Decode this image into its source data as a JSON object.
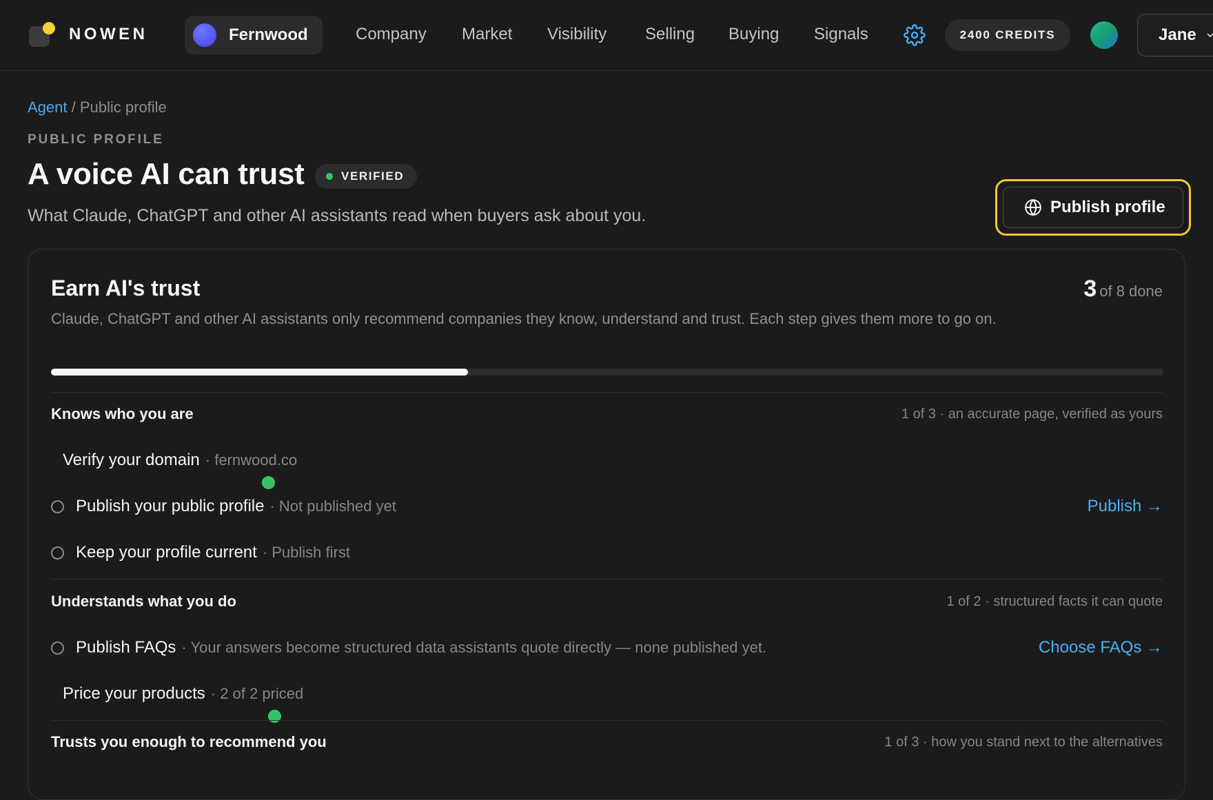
{
  "nav": {
    "brand": "NOWEN",
    "workspace": "Fernwood",
    "links": [
      "Company",
      "Market",
      "Visibility",
      "Selling",
      "Buying",
      "Signals"
    ],
    "credits": "2400 CREDITS",
    "user": "Jane"
  },
  "breadcrumb": {
    "root": "Agent",
    "separator": " / ",
    "current": "Public profile"
  },
  "header": {
    "eyebrow": "PUBLIC PROFILE",
    "title": "A voice AI can trust",
    "badge": "VERIFIED",
    "subtitle": "What Claude, ChatGPT and other AI assistants read when buyers ask about you.",
    "publish_button": "Publish profile"
  },
  "card": {
    "title": "Earn AI's trust",
    "done_count": "3",
    "done_suffix": "of 8 done",
    "progress_fraction": 0.375,
    "description": "Claude, ChatGPT and other AI assistants only recommend companies they know, understand and trust. Each step gives them more to go on.",
    "sections": [
      {
        "title": "Knows who you are",
        "meta": "1 of 3 · an accurate page, verified as yours",
        "steps": [
          {
            "label": "Verify your domain",
            "detail": "· fernwood.co",
            "status": "done"
          },
          {
            "label": "Publish your public profile",
            "detail": "· Not published yet",
            "status": "todo",
            "action": "Publish →"
          },
          {
            "label": "Keep your profile current",
            "detail": "· Publish first",
            "status": "todo"
          }
        ]
      },
      {
        "title": "Understands what you do",
        "meta": "1 of 2 · structured facts it can quote",
        "steps": [
          {
            "label": "Publish FAQs",
            "detail": "· Your answers become structured data assistants quote directly — none published yet.",
            "status": "todo",
            "action": "Choose FAQs →"
          },
          {
            "label": "Price your products",
            "detail": "· 2 of 2 priced",
            "status": "done"
          }
        ]
      },
      {
        "title": "Trusts you enough to recommend you",
        "meta": "1 of 3 · how you stand next to the alternatives"
      }
    ]
  },
  "colors": {
    "accent": "#4aaef5",
    "highlight": "#f2c834",
    "success": "#34c463"
  }
}
